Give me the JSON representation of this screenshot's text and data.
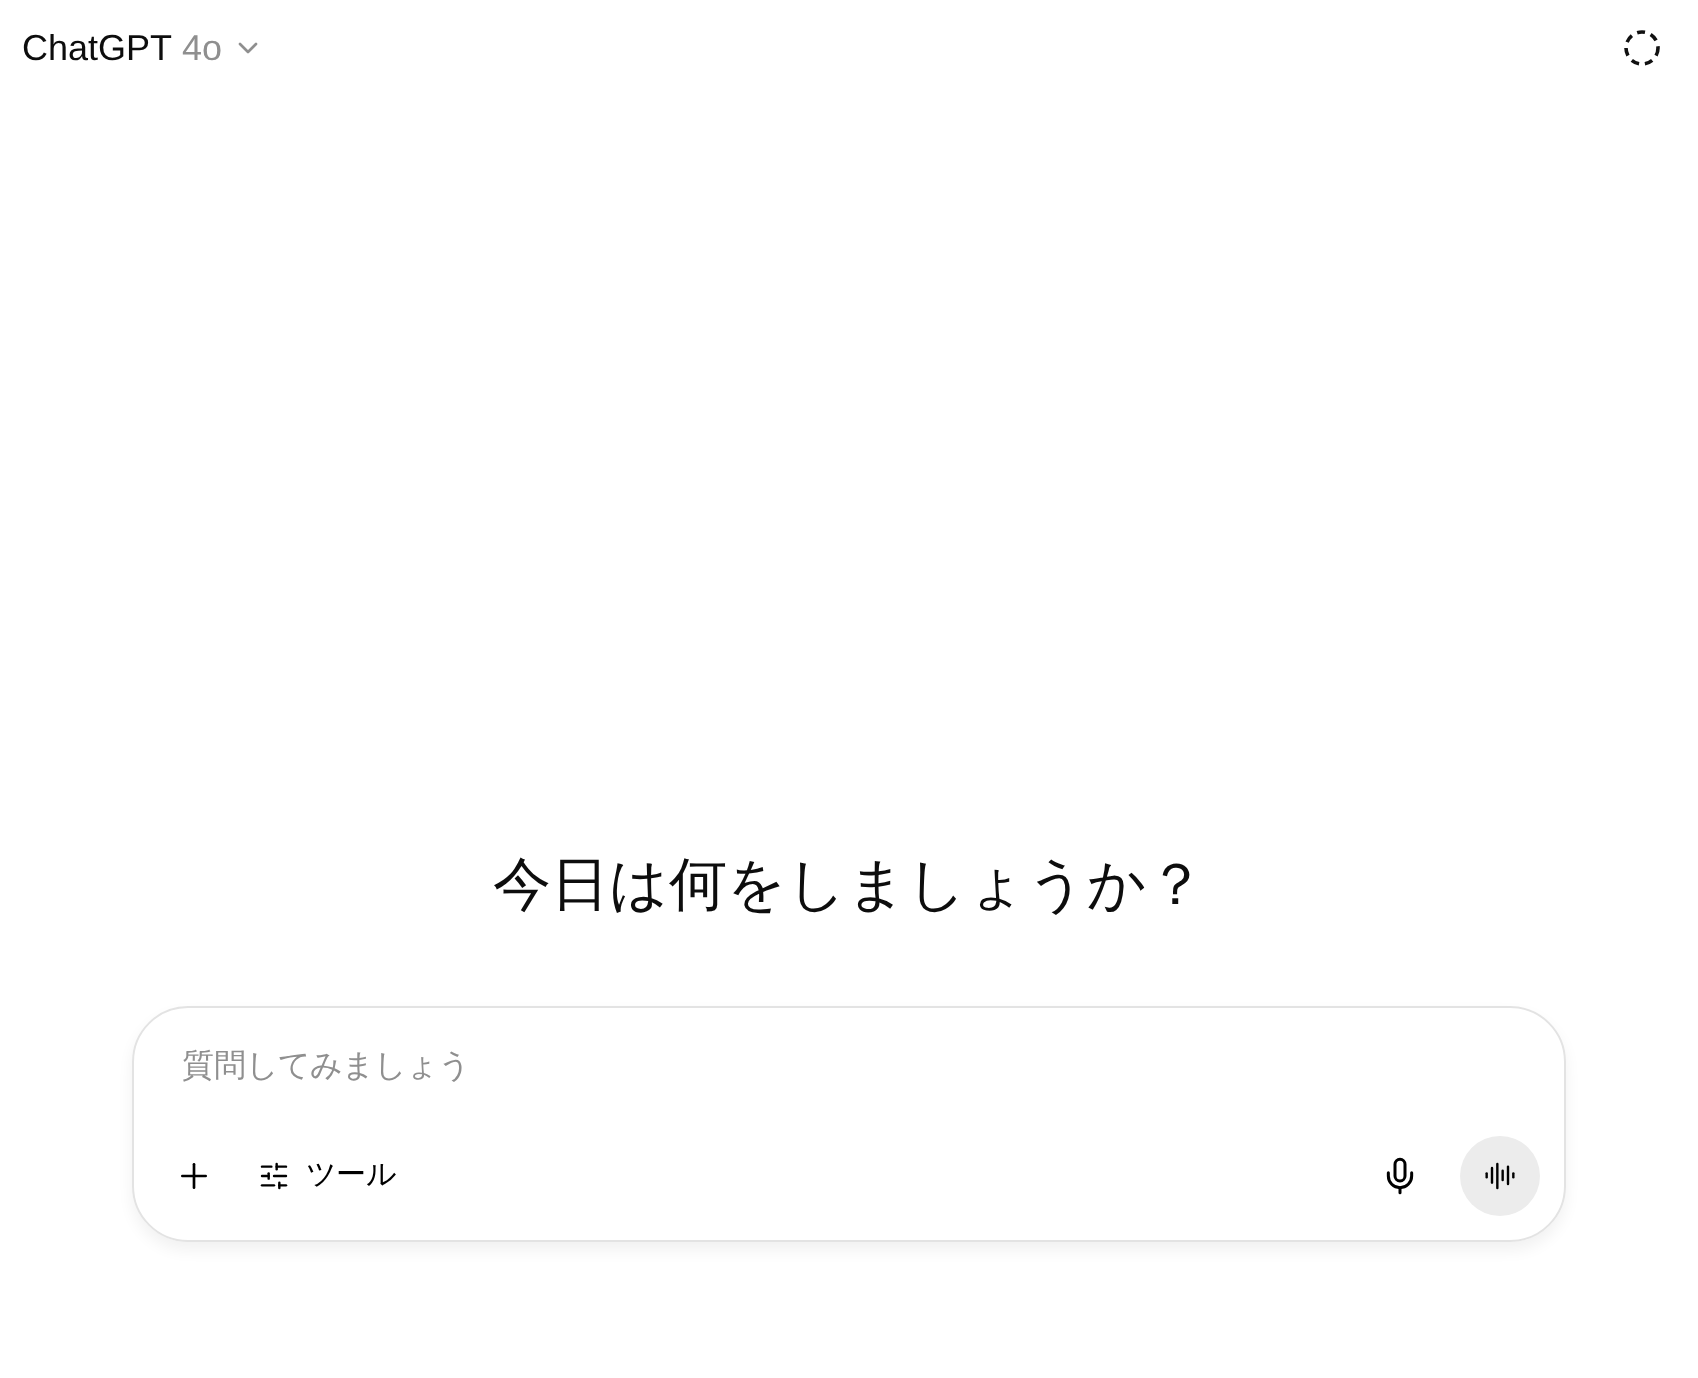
{
  "header": {
    "title": "ChatGPT",
    "model": "4o"
  },
  "greeting": "今日は何をしましょうか？",
  "composer": {
    "placeholder": "質問してみましょう",
    "tools_label": "ツール"
  }
}
